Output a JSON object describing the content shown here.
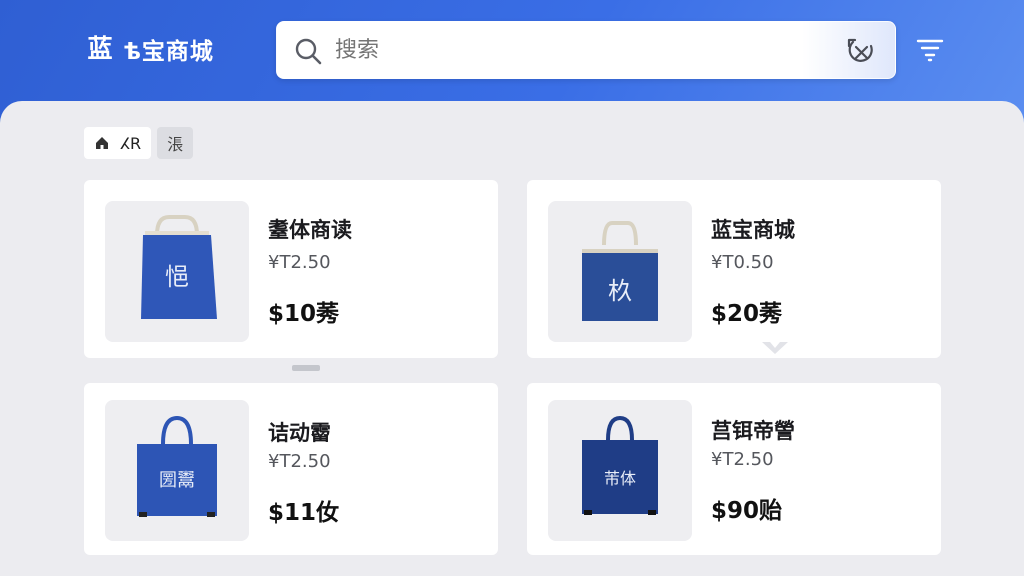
{
  "header": {
    "logo_mark": "蓝",
    "app_name": "ѣ宝商城",
    "search_placeholder": "搜索",
    "icons": {
      "search": "search-icon",
      "scan": "scan-icon",
      "filter": "filter-icon"
    }
  },
  "chips": {
    "active_label": "ⵃR",
    "plain_label": "涱"
  },
  "products": [
    {
      "name": "耋体商读",
      "old_price": "¥T2.50",
      "price": "$10莠",
      "bag_label": "悒",
      "bag_color": "#2f57b8"
    },
    {
      "name": "蓝宝商城",
      "old_price": "¥T0.50",
      "price": "$20莠",
      "bag_label": "杦",
      "bag_color": "#2a4e98"
    },
    {
      "name": "诘动霤",
      "old_price": "¥T2.50",
      "price": "$11㚢",
      "bag_label": "圐鬻",
      "bag_color": "#2d55b5"
    },
    {
      "name": "莒铒帝謍",
      "old_price": "¥T2.50",
      "price": "$90贻",
      "bag_label": "芾体",
      "bag_color": "#1f3d86"
    }
  ],
  "colors": {
    "header_blue": "#3a6ee6",
    "panel_bg": "#ececf0",
    "card_bg": "#ffffff"
  }
}
